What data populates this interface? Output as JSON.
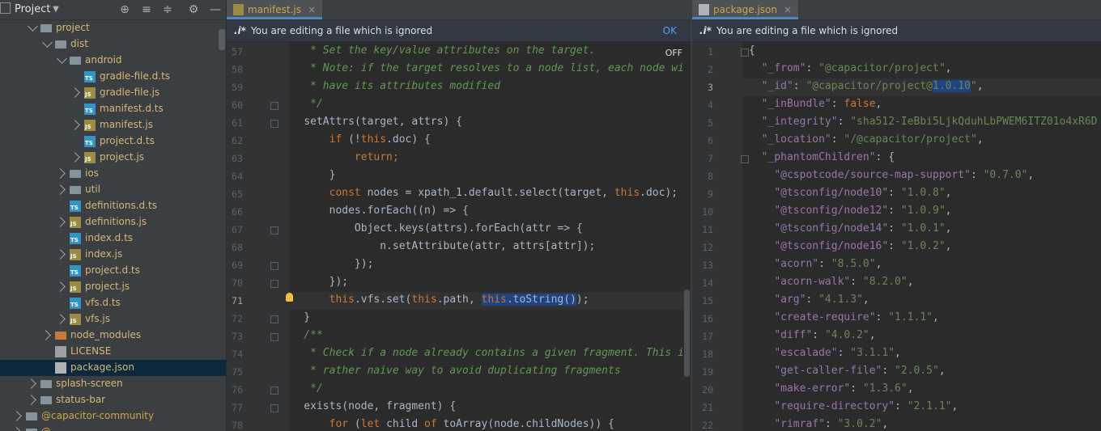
{
  "project_panel": {
    "title": "Project",
    "tree": [
      {
        "label": "project",
        "depth": 3,
        "type": "folder",
        "state": "open"
      },
      {
        "label": "dist",
        "depth": 4,
        "type": "folder",
        "state": "open"
      },
      {
        "label": "android",
        "depth": 5,
        "type": "folder",
        "state": "open"
      },
      {
        "label": "gradle-file.d.ts",
        "depth": 6,
        "type": "ts",
        "state": "leaf"
      },
      {
        "label": "gradle-file.js",
        "depth": 6,
        "type": "js",
        "state": "closed"
      },
      {
        "label": "manifest.d.ts",
        "depth": 6,
        "type": "ts",
        "state": "leaf"
      },
      {
        "label": "manifest.js",
        "depth": 6,
        "type": "js",
        "state": "closed"
      },
      {
        "label": "project.d.ts",
        "depth": 6,
        "type": "ts",
        "state": "leaf"
      },
      {
        "label": "project.js",
        "depth": 6,
        "type": "js",
        "state": "closed"
      },
      {
        "label": "ios",
        "depth": 5,
        "type": "folder",
        "state": "closed"
      },
      {
        "label": "util",
        "depth": 5,
        "type": "folder",
        "state": "closed"
      },
      {
        "label": "definitions.d.ts",
        "depth": 5,
        "type": "ts",
        "state": "leaf"
      },
      {
        "label": "definitions.js",
        "depth": 5,
        "type": "js",
        "state": "closed"
      },
      {
        "label": "index.d.ts",
        "depth": 5,
        "type": "ts",
        "state": "leaf"
      },
      {
        "label": "index.js",
        "depth": 5,
        "type": "js",
        "state": "closed"
      },
      {
        "label": "project.d.ts",
        "depth": 5,
        "type": "ts",
        "state": "leaf"
      },
      {
        "label": "project.js",
        "depth": 5,
        "type": "js",
        "state": "closed"
      },
      {
        "label": "vfs.d.ts",
        "depth": 5,
        "type": "ts",
        "state": "leaf"
      },
      {
        "label": "vfs.js",
        "depth": 5,
        "type": "js",
        "state": "closed"
      },
      {
        "label": "node_modules",
        "depth": 4,
        "type": "folder-orange",
        "state": "closed"
      },
      {
        "label": "LICENSE",
        "depth": 4,
        "type": "txt",
        "state": "leaf"
      },
      {
        "label": "package.json",
        "depth": 4,
        "type": "json",
        "state": "leaf",
        "selected": true
      },
      {
        "label": "splash-screen",
        "depth": 3,
        "type": "folder",
        "state": "closed"
      },
      {
        "label": "status-bar",
        "depth": 3,
        "type": "folder",
        "state": "closed"
      },
      {
        "label": "@capacitor-community",
        "depth": 2,
        "type": "folder",
        "state": "closed"
      },
      {
        "label": "@...",
        "depth": 2,
        "type": "folder",
        "state": "closed"
      }
    ]
  },
  "left_editor": {
    "tab_label": "manifest.js",
    "banner_text": "You are editing a file which is ignored",
    "banner_action": "OK",
    "off_label": "OFF",
    "first_line": 57,
    "lines": [
      [
        {
          "t": "     * Set the key/value attributes on the target.",
          "c": "cmt"
        }
      ],
      [
        {
          "t": "     * Note: if the target resolves to a node list, each node wi",
          "c": "cmt"
        }
      ],
      [
        {
          "t": "     * have its attributes modified",
          "c": "cmt"
        }
      ],
      [
        {
          "t": "     */",
          "c": "cmt"
        }
      ],
      [
        {
          "t": "    ",
          "c": ""
        },
        {
          "t": "setAttrs",
          "c": ""
        },
        {
          "t": "(target, attrs) {",
          "c": ""
        }
      ],
      [
        {
          "t": "        ",
          "c": ""
        },
        {
          "t": "if",
          "c": "kw"
        },
        {
          "t": " (!",
          "c": ""
        },
        {
          "t": "this",
          "c": "kw"
        },
        {
          "t": ".doc) {",
          "c": ""
        }
      ],
      [
        {
          "t": "            ",
          "c": ""
        },
        {
          "t": "return",
          "c": "kw"
        },
        {
          "t": ";",
          "c": "kw"
        }
      ],
      [
        {
          "t": "        }",
          "c": ""
        }
      ],
      [
        {
          "t": "        ",
          "c": ""
        },
        {
          "t": "const",
          "c": "kw"
        },
        {
          "t": " nodes = xpath_1.default.select(target, ",
          "c": ""
        },
        {
          "t": "this",
          "c": "kw"
        },
        {
          "t": ".doc);",
          "c": ""
        }
      ],
      [
        {
          "t": "        nodes.forEach((n) => {",
          "c": ""
        }
      ],
      [
        {
          "t": "            Object.keys(attrs).forEach(attr => {",
          "c": ""
        }
      ],
      [
        {
          "t": "                n.setAttribute(attr, attrs[attr]);",
          "c": ""
        }
      ],
      [
        {
          "t": "            });",
          "c": ""
        }
      ],
      [
        {
          "t": "        });",
          "c": ""
        }
      ],
      [
        {
          "t": "        ",
          "c": ""
        },
        {
          "t": "this",
          "c": "kw"
        },
        {
          "t": ".vfs.set(",
          "c": ""
        },
        {
          "t": "this",
          "c": "kw"
        },
        {
          "t": ".path, ",
          "c": ""
        },
        {
          "t": "this",
          "c": "kw sel"
        },
        {
          "t": ".toString()",
          "c": "sel"
        },
        {
          "t": ");",
          "c": ""
        }
      ],
      [
        {
          "t": "    }",
          "c": ""
        }
      ],
      [
        {
          "t": "    /**",
          "c": "cmt"
        }
      ],
      [
        {
          "t": "     * Check if a node already contains a given fragment. This i",
          "c": "cmt"
        }
      ],
      [
        {
          "t": "     * rather naive way to avoid duplicating fragments",
          "c": "cmt"
        }
      ],
      [
        {
          "t": "     */",
          "c": "cmt"
        }
      ],
      [
        {
          "t": "    exists(node, fragment) {",
          "c": ""
        }
      ],
      [
        {
          "t": "        ",
          "c": ""
        },
        {
          "t": "for",
          "c": "kw"
        },
        {
          "t": " (",
          "c": ""
        },
        {
          "t": "let",
          "c": "kw"
        },
        {
          "t": " child ",
          "c": ""
        },
        {
          "t": "of",
          "c": "kw"
        },
        {
          "t": " toArray(node.childNodes)) {",
          "c": ""
        }
      ]
    ]
  },
  "right_editor": {
    "tab_label": "package.json",
    "banner_text": "You are editing a file which is ignored",
    "first_line": 1,
    "lines": [
      [
        {
          "t": "{",
          "c": ""
        }
      ],
      [
        {
          "t": "  ",
          "c": ""
        },
        {
          "t": "\"_from\"",
          "c": "key"
        },
        {
          "t": ": ",
          "c": ""
        },
        {
          "t": "\"@capacitor/project\"",
          "c": "str"
        },
        {
          "t": ",",
          "c": ""
        }
      ],
      [
        {
          "t": "  ",
          "c": ""
        },
        {
          "t": "\"_id\"",
          "c": "key"
        },
        {
          "t": ": ",
          "c": ""
        },
        {
          "t": "\"@capacitor/project@",
          "c": "str"
        },
        {
          "t": "1.0.10",
          "c": "str sel"
        },
        {
          "t": "\"",
          "c": "str"
        },
        {
          "t": ",",
          "c": ""
        }
      ],
      [
        {
          "t": "  ",
          "c": ""
        },
        {
          "t": "\"_inBundle\"",
          "c": "key"
        },
        {
          "t": ": ",
          "c": ""
        },
        {
          "t": "false",
          "c": "kw"
        },
        {
          "t": ",",
          "c": ""
        }
      ],
      [
        {
          "t": "  ",
          "c": ""
        },
        {
          "t": "\"_integrity\"",
          "c": "key"
        },
        {
          "t": ": ",
          "c": ""
        },
        {
          "t": "\"sha512-IeBbi5LjkQduhLbPWEM6ITZ01o4xR6D",
          "c": "str"
        }
      ],
      [
        {
          "t": "  ",
          "c": ""
        },
        {
          "t": "\"_location\"",
          "c": "key"
        },
        {
          "t": ": ",
          "c": ""
        },
        {
          "t": "\"/@capacitor/project\"",
          "c": "str"
        },
        {
          "t": ",",
          "c": ""
        }
      ],
      [
        {
          "t": "  ",
          "c": ""
        },
        {
          "t": "\"_phantomChildren\"",
          "c": "key"
        },
        {
          "t": ": {",
          "c": ""
        }
      ],
      [
        {
          "t": "    ",
          "c": ""
        },
        {
          "t": "\"@cspotcode/source-map-support\"",
          "c": "key"
        },
        {
          "t": ": ",
          "c": ""
        },
        {
          "t": "\"0.7.0\"",
          "c": "str"
        },
        {
          "t": ",",
          "c": ""
        }
      ],
      [
        {
          "t": "    ",
          "c": ""
        },
        {
          "t": "\"@tsconfig/node10\"",
          "c": "key"
        },
        {
          "t": ": ",
          "c": ""
        },
        {
          "t": "\"1.0.8\"",
          "c": "str"
        },
        {
          "t": ",",
          "c": ""
        }
      ],
      [
        {
          "t": "    ",
          "c": ""
        },
        {
          "t": "\"@tsconfig/node12\"",
          "c": "key"
        },
        {
          "t": ": ",
          "c": ""
        },
        {
          "t": "\"1.0.9\"",
          "c": "str"
        },
        {
          "t": ",",
          "c": ""
        }
      ],
      [
        {
          "t": "    ",
          "c": ""
        },
        {
          "t": "\"@tsconfig/node14\"",
          "c": "key"
        },
        {
          "t": ": ",
          "c": ""
        },
        {
          "t": "\"1.0.1\"",
          "c": "str"
        },
        {
          "t": ",",
          "c": ""
        }
      ],
      [
        {
          "t": "    ",
          "c": ""
        },
        {
          "t": "\"@tsconfig/node16\"",
          "c": "key"
        },
        {
          "t": ": ",
          "c": ""
        },
        {
          "t": "\"1.0.2\"",
          "c": "str"
        },
        {
          "t": ",",
          "c": ""
        }
      ],
      [
        {
          "t": "    ",
          "c": ""
        },
        {
          "t": "\"acorn\"",
          "c": "key"
        },
        {
          "t": ": ",
          "c": ""
        },
        {
          "t": "\"8.5.0\"",
          "c": "str"
        },
        {
          "t": ",",
          "c": ""
        }
      ],
      [
        {
          "t": "    ",
          "c": ""
        },
        {
          "t": "\"acorn-walk\"",
          "c": "key"
        },
        {
          "t": ": ",
          "c": ""
        },
        {
          "t": "\"8.2.0\"",
          "c": "str"
        },
        {
          "t": ",",
          "c": ""
        }
      ],
      [
        {
          "t": "    ",
          "c": ""
        },
        {
          "t": "\"arg\"",
          "c": "key"
        },
        {
          "t": ": ",
          "c": ""
        },
        {
          "t": "\"4.1.3\"",
          "c": "str"
        },
        {
          "t": ",",
          "c": ""
        }
      ],
      [
        {
          "t": "    ",
          "c": ""
        },
        {
          "t": "\"create-require\"",
          "c": "key"
        },
        {
          "t": ": ",
          "c": ""
        },
        {
          "t": "\"1.1.1\"",
          "c": "str"
        },
        {
          "t": ",",
          "c": ""
        }
      ],
      [
        {
          "t": "    ",
          "c": ""
        },
        {
          "t": "\"diff\"",
          "c": "key"
        },
        {
          "t": ": ",
          "c": ""
        },
        {
          "t": "\"4.0.2\"",
          "c": "str"
        },
        {
          "t": ",",
          "c": ""
        }
      ],
      [
        {
          "t": "    ",
          "c": ""
        },
        {
          "t": "\"escalade\"",
          "c": "key"
        },
        {
          "t": ": ",
          "c": ""
        },
        {
          "t": "\"3.1.1\"",
          "c": "str"
        },
        {
          "t": ",",
          "c": ""
        }
      ],
      [
        {
          "t": "    ",
          "c": ""
        },
        {
          "t": "\"get-caller-file\"",
          "c": "key"
        },
        {
          "t": ": ",
          "c": ""
        },
        {
          "t": "\"2.0.5\"",
          "c": "str"
        },
        {
          "t": ",",
          "c": ""
        }
      ],
      [
        {
          "t": "    ",
          "c": ""
        },
        {
          "t": "\"make-error\"",
          "c": "key"
        },
        {
          "t": ": ",
          "c": ""
        },
        {
          "t": "\"1.3.6\"",
          "c": "str"
        },
        {
          "t": ",",
          "c": ""
        }
      ],
      [
        {
          "t": "    ",
          "c": ""
        },
        {
          "t": "\"require-directory\"",
          "c": "key"
        },
        {
          "t": ": ",
          "c": ""
        },
        {
          "t": "\"2.1.1\"",
          "c": "str"
        },
        {
          "t": ",",
          "c": ""
        }
      ],
      [
        {
          "t": "    ",
          "c": ""
        },
        {
          "t": "\"rimraf\"",
          "c": "key"
        },
        {
          "t": ": ",
          "c": ""
        },
        {
          "t": "\"3.0.2\"",
          "c": "str"
        },
        {
          "t": ",",
          "c": ""
        }
      ]
    ]
  }
}
